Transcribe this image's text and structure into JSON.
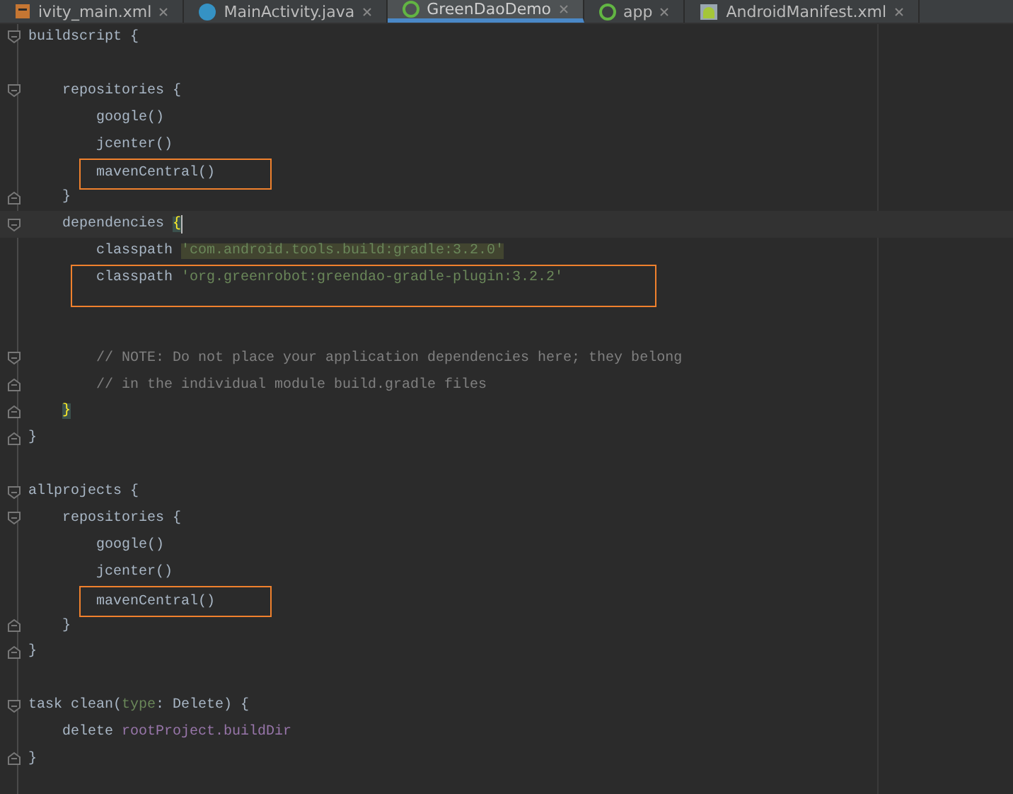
{
  "tabs": [
    {
      "label": "ivity_main.xml",
      "kind": "xml",
      "selected": false
    },
    {
      "label": "MainActivity.java",
      "kind": "java",
      "selected": false
    },
    {
      "label": "GreenDaoDemo",
      "kind": "gradle",
      "selected": true
    },
    {
      "label": "app",
      "kind": "gradle",
      "selected": false
    },
    {
      "label": "AndroidManifest.xml",
      "kind": "manifest",
      "selected": false
    }
  ],
  "editor": {
    "lines": [
      {
        "kind": "code",
        "fold_start": true,
        "tokens": [
          {
            "kind": "text",
            "text": "buildscript {"
          }
        ],
        "children": [
          {
            "kind": "blank"
          },
          {
            "kind": "code",
            "fold_start": true,
            "tokens": [
              {
                "kind": "text",
                "text": "repositories {"
              }
            ],
            "children": [
              {
                "kind": "code",
                "tokens": [
                  {
                    "kind": "text",
                    "text": "google()"
                  }
                ]
              },
              {
                "kind": "code",
                "tokens": [
                  {
                    "kind": "text",
                    "text": "jcenter()"
                  }
                ]
              },
              {
                "kind": "code",
                "boxed": true,
                "tokens": [
                  {
                    "kind": "text",
                    "text": "mavenCentral()"
                  }
                ]
              }
            ]
          },
          {
            "kind": "code",
            "fold_end": true,
            "tokens": [
              {
                "kind": "text",
                "text": "}"
              }
            ]
          },
          {
            "kind": "code",
            "fold_start": true,
            "current": true,
            "tokens": [
              {
                "kind": "text",
                "text": "dependencies "
              },
              {
                "kind": "brace",
                "text": "{"
              }
            ],
            "children": [
              {
                "kind": "code",
                "tokens": [
                  {
                    "kind": "text",
                    "text": "classpath "
                  },
                  {
                    "kind": "string",
                    "highlighted": true,
                    "text": "'com.android.tools.build:gradle:3.2.0'"
                  }
                ]
              },
              {
                "kind": "code",
                "boxed": true,
                "tokens": [
                  {
                    "kind": "text",
                    "text": "classpath "
                  },
                  {
                    "kind": "string",
                    "highlighted": false,
                    "text": "'org.greenrobot:greendao-gradle-plugin:3.2.2'"
                  }
                ]
              },
              {
                "kind": "blank",
                "boxed": true
              },
              {
                "kind": "blank"
              },
              {
                "kind": "code",
                "fold_start": true,
                "tokens": [
                  {
                    "kind": "comment",
                    "text": "// NOTE: Do not place your application dependencies here; they belong"
                  }
                ]
              },
              {
                "kind": "code",
                "fold_end": true,
                "tokens": [
                  {
                    "kind": "comment",
                    "text": "// in the individual module build.gradle files"
                  }
                ]
              }
            ]
          },
          {
            "kind": "code",
            "fold_end": true,
            "tokens": [
              {
                "kind": "brace",
                "text": "}"
              }
            ]
          }
        ]
      },
      {
        "kind": "code",
        "fold_end": true,
        "tokens": [
          {
            "kind": "text",
            "text": "}"
          }
        ]
      },
      {
        "kind": "blank"
      },
      {
        "kind": "code",
        "fold_start": true,
        "tokens": [
          {
            "kind": "text",
            "text": "allprojects {"
          }
        ],
        "children": [
          {
            "kind": "code",
            "fold_start": true,
            "tokens": [
              {
                "kind": "text",
                "text": "repositories {"
              }
            ],
            "children": [
              {
                "kind": "code",
                "tokens": [
                  {
                    "kind": "text",
                    "text": "google()"
                  }
                ]
              },
              {
                "kind": "code",
                "tokens": [
                  {
                    "kind": "text",
                    "text": "jcenter()"
                  }
                ]
              },
              {
                "kind": "code",
                "boxed": true,
                "tokens": [
                  {
                    "kind": "text",
                    "text": "mavenCentral()"
                  }
                ]
              }
            ]
          },
          {
            "kind": "code",
            "fold_end": true,
            "tokens": [
              {
                "kind": "text",
                "text": "}"
              }
            ]
          }
        ]
      },
      {
        "kind": "code",
        "fold_end": true,
        "tokens": [
          {
            "kind": "text",
            "text": "}"
          }
        ]
      },
      {
        "kind": "blank"
      },
      {
        "kind": "code",
        "fold_start": true,
        "tokens": [
          {
            "kind": "text",
            "text": "task clean("
          },
          {
            "kind": "named_arg",
            "text": "type"
          },
          {
            "kind": "text",
            "text": ": Delete) {"
          }
        ],
        "children": [
          {
            "kind": "code",
            "tokens": [
              {
                "kind": "text",
                "text": "delete "
              },
              {
                "kind": "field",
                "text": "rootProject.buildDir"
              }
            ]
          }
        ]
      },
      {
        "kind": "code",
        "fold_end": true,
        "tokens": [
          {
            "kind": "text",
            "text": "}"
          }
        ]
      }
    ]
  }
}
